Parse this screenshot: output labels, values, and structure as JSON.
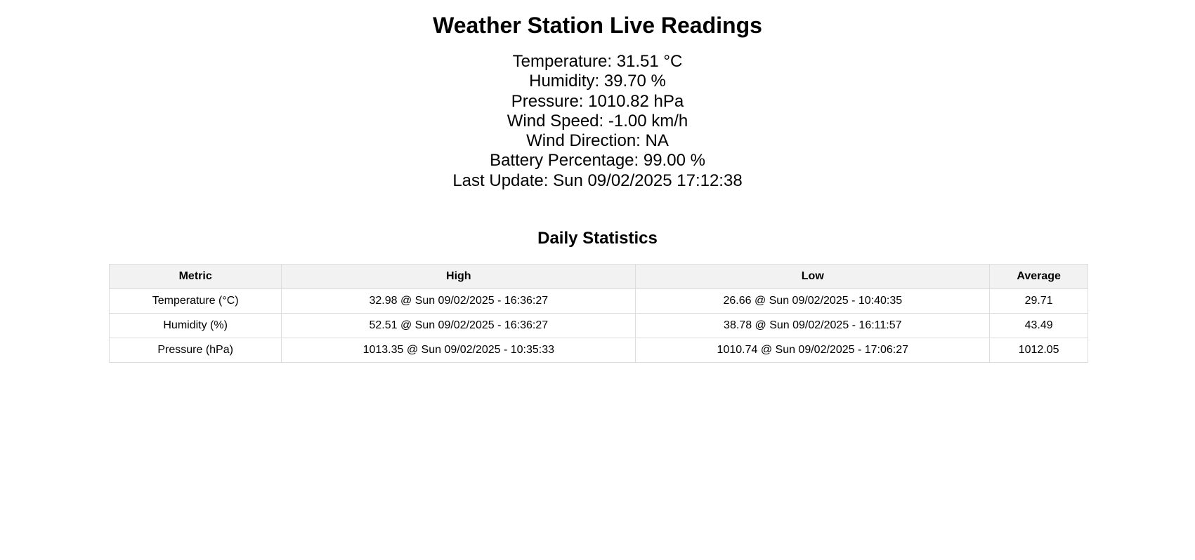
{
  "page": {
    "title": "Weather Station Live Readings"
  },
  "readings": [
    "Temperature: 31.51 °C",
    "Humidity: 39.70 %",
    "Pressure: 1010.82 hPa",
    "Wind Speed: -1.00 km/h",
    "Wind Direction: NA",
    "Battery Percentage: 99.00 %",
    "Last Update: Sun 09/02/2025 17:12:38"
  ],
  "stats": {
    "title": "Daily Statistics",
    "headers": [
      "Metric",
      "High",
      "Low",
      "Average"
    ],
    "rows": [
      [
        "Temperature (°C)",
        "32.98 @ Sun 09/02/2025 - 16:36:27",
        "26.66 @ Sun 09/02/2025 - 10:40:35",
        "29.71"
      ],
      [
        "Humidity (%)",
        "52.51 @ Sun 09/02/2025 - 16:36:27",
        "38.78 @ Sun 09/02/2025 - 16:11:57",
        "43.49"
      ],
      [
        "Pressure (hPa)",
        "1013.35 @ Sun 09/02/2025 - 10:35:33",
        "1010.74 @ Sun 09/02/2025 - 17:06:27",
        "1012.05"
      ]
    ]
  }
}
